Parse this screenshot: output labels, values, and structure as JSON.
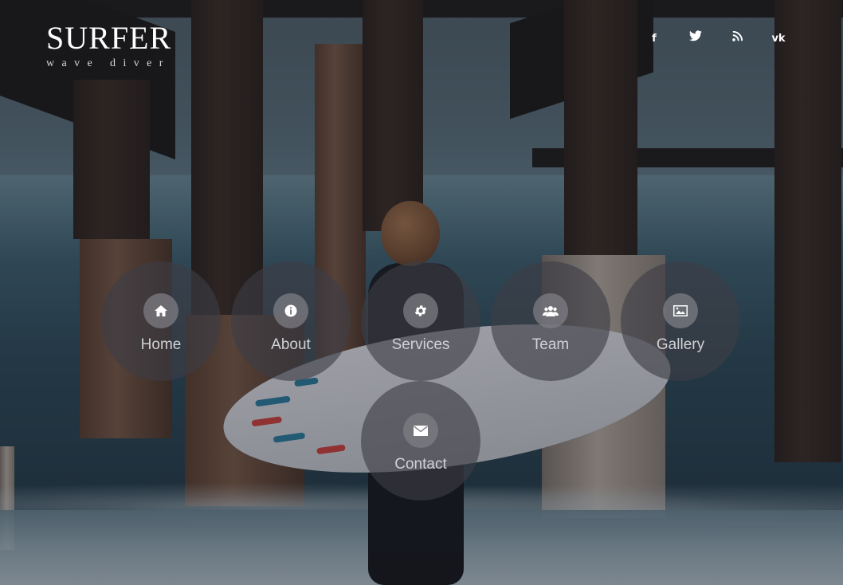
{
  "brand": {
    "title": "SURFER",
    "tagline": "wave diver"
  },
  "social": [
    {
      "name": "facebook",
      "glyph": "f"
    },
    {
      "name": "twitter",
      "glyph": "🐦"
    },
    {
      "name": "rss",
      "glyph": "≋"
    },
    {
      "name": "vk",
      "glyph": "vk"
    }
  ],
  "menu": [
    {
      "label": "Home",
      "icon": "home-icon"
    },
    {
      "label": "About",
      "icon": "info-icon"
    },
    {
      "label": "Services",
      "icon": "gear-icon"
    },
    {
      "label": "Team",
      "icon": "users-icon"
    },
    {
      "label": "Gallery",
      "icon": "image-icon"
    },
    {
      "label": "Contact",
      "icon": "envelope-icon"
    }
  ],
  "colors": {
    "circle": "#3e3e46",
    "icon_bg": "#7d7d84",
    "label": "#d0d1d5",
    "text": "#ffffff"
  }
}
